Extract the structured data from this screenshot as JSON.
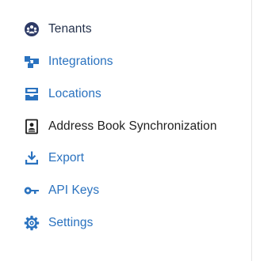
{
  "menu": {
    "items": [
      {
        "label": "Tenants",
        "icon": "tenants-icon"
      },
      {
        "label": "Integrations",
        "icon": "integrations-icon"
      },
      {
        "label": "Locations",
        "icon": "locations-icon"
      },
      {
        "label": "Address Book Synchronization",
        "icon": "address-book-icon"
      },
      {
        "label": "Export",
        "icon": "export-icon"
      },
      {
        "label": "API Keys",
        "icon": "key-icon"
      },
      {
        "label": "Settings",
        "icon": "settings-gear-icon"
      }
    ]
  },
  "colors": {
    "link_blue": "#2a72bf",
    "active_dark_navy": "#26334d",
    "text_black": "#1f1f1f",
    "icon_dark_navy": "#2d3a66"
  }
}
